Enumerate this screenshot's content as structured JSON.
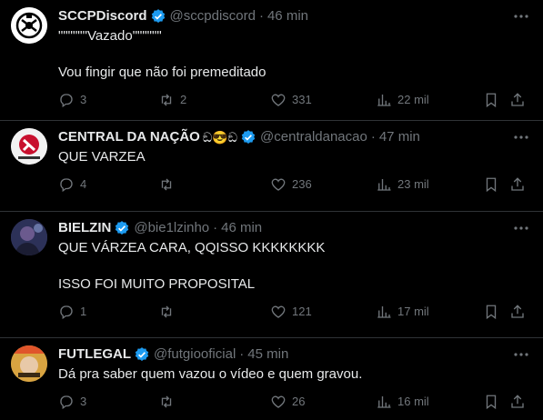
{
  "tweets": [
    {
      "name": "SCCPDiscord",
      "name_suffix": "",
      "handle": "@sccpdiscord",
      "time": "46 min",
      "text": "\"\"\"\"\"\"Vazado\"\"\"\"\"\"\n\nVou fingir que não foi premeditado",
      "replies": "3",
      "retweets": "2",
      "likes": "331",
      "views": "22 mil",
      "avatar_icon": "corinthians-logo"
    },
    {
      "name": "CENTRAL DA NAÇÃO",
      "name_suffix": "ඞ😎ඞ",
      "handle": "@centraldanacao",
      "time": "47 min",
      "text": "QUE VARZEA",
      "replies": "4",
      "retweets": "",
      "likes": "236",
      "views": "23 mil",
      "avatar_icon": "central-da-nacao-logo"
    },
    {
      "name": "BIELZIN",
      "name_suffix": "",
      "handle": "@bie1lzinho",
      "time": "46 min",
      "text": "QUE VÁRZEA CARA, QQISSO KKKKKKKK\n\nISSO FOI MUITO PROPOSITAL",
      "replies": "1",
      "retweets": "",
      "likes": "121",
      "views": "17 mil",
      "avatar_icon": "user-photo"
    },
    {
      "name": "FUTLEGAL",
      "name_suffix": "",
      "handle": "@futgiooficial",
      "time": "45 min",
      "text": "Dá pra saber quem vazou o vídeo e quem gravou.",
      "replies": "3",
      "retweets": "",
      "likes": "26",
      "views": "16 mil",
      "avatar_icon": "futlegal-photo"
    }
  ],
  "colors": {
    "background": "#000000",
    "text": "#e7e9ea",
    "muted": "#71767b",
    "verified": "#1d9bf0",
    "divider": "#2f3336"
  }
}
